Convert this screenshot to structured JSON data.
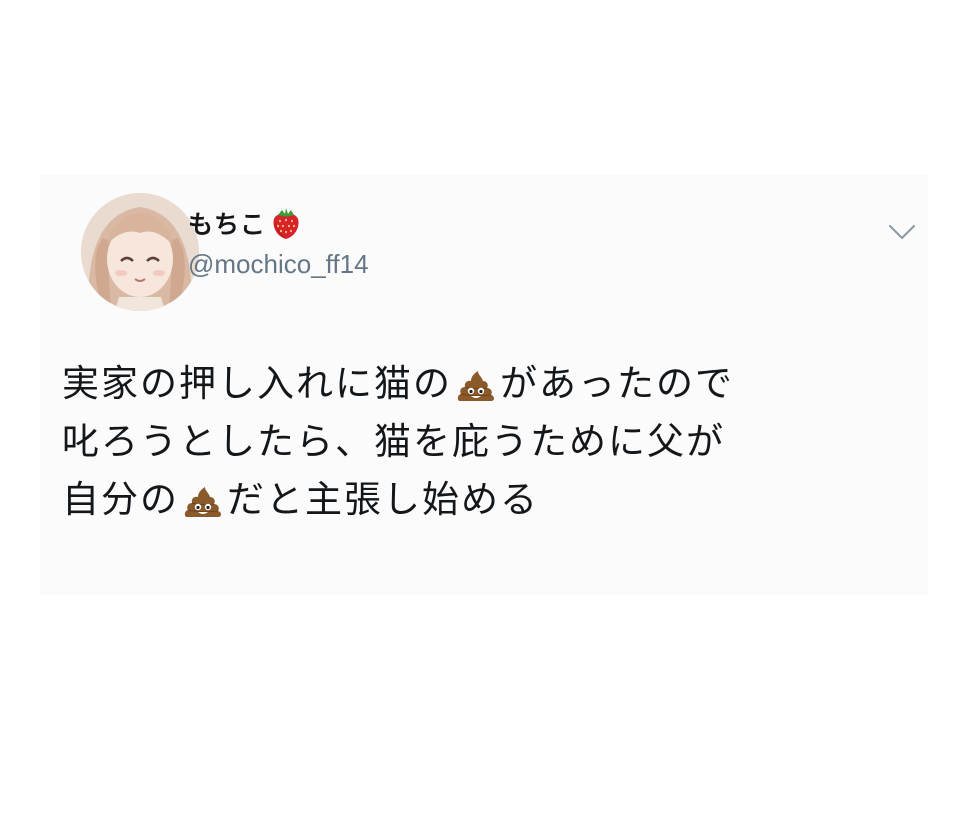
{
  "tweet": {
    "display_name": "もちこ",
    "display_name_emoji": "strawberry-icon",
    "handle": "@mochico_ff14",
    "menu_icon": "chevron-down-icon",
    "text_lines": [
      {
        "before": "実家の押し入れに猫の",
        "emoji": "pile-of-poo-icon",
        "after": "があったので"
      },
      {
        "before": "叱ろうとしたら、猫を庇うために父が",
        "emoji": null,
        "after": ""
      },
      {
        "before": "自分の",
        "emoji": "pile-of-poo-icon",
        "after": "だと主張し始める"
      }
    ]
  },
  "colors": {
    "card_background": "#fbfbfb",
    "text_primary": "#14171a",
    "text_secondary": "#657786",
    "chevron": "#8899a6"
  }
}
